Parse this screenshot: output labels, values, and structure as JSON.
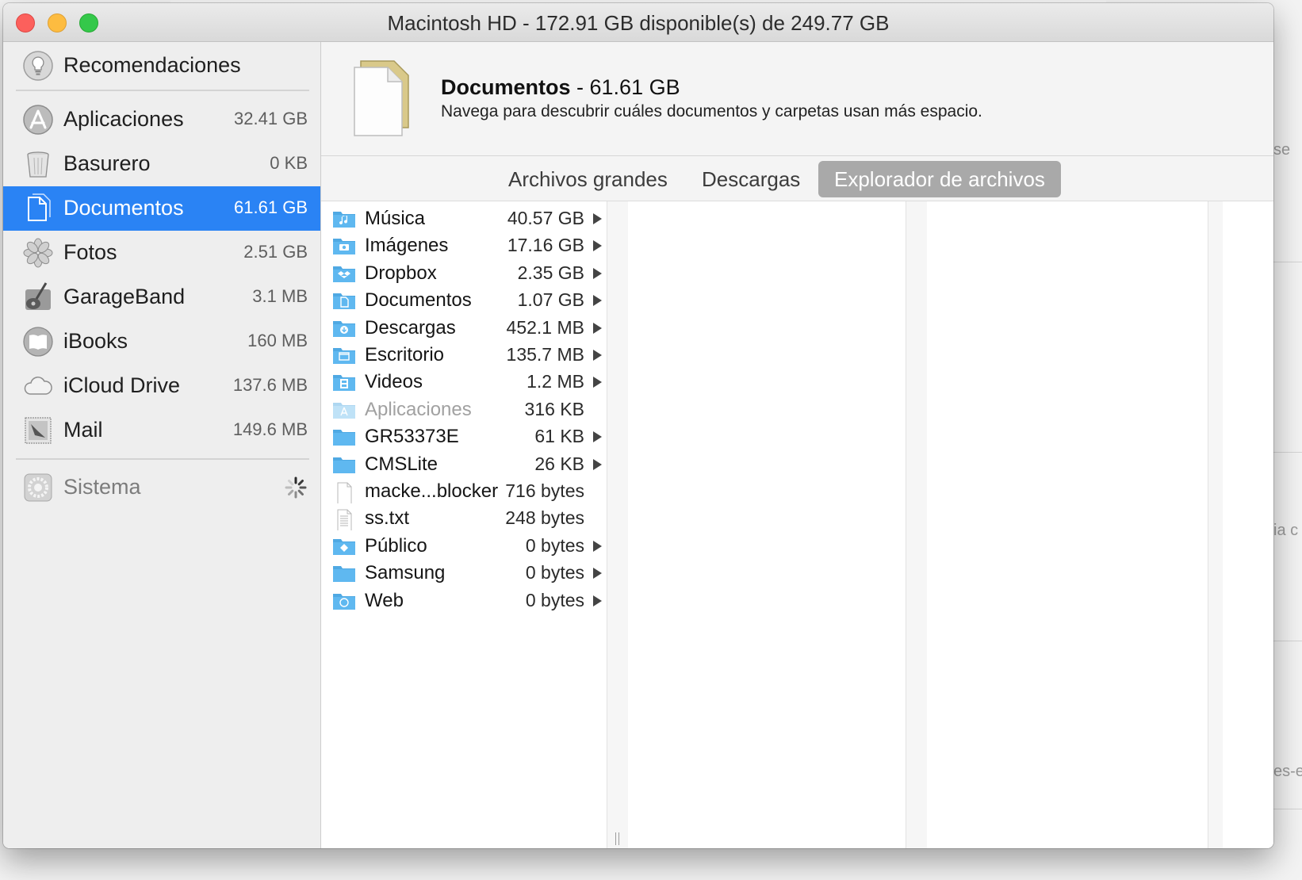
{
  "window": {
    "title": "Macintosh HD - 172.91 GB disponible(s) de 249.77 GB"
  },
  "sidebar": {
    "recommendations": {
      "label": "Recomendaciones",
      "icon": "lightbulb-icon"
    },
    "items": [
      {
        "label": "Aplicaciones",
        "size": "32.41 GB",
        "icon": "applications-icon",
        "selected": false
      },
      {
        "label": "Basurero",
        "size": "0 KB",
        "icon": "trash-icon",
        "selected": false
      },
      {
        "label": "Documentos",
        "size": "61.61 GB",
        "icon": "documents-icon",
        "selected": true
      },
      {
        "label": "Fotos",
        "size": "2.51 GB",
        "icon": "photos-icon",
        "selected": false
      },
      {
        "label": "GarageBand",
        "size": "3.1 MB",
        "icon": "garageband-icon",
        "selected": false
      },
      {
        "label": "iBooks",
        "size": "160 MB",
        "icon": "ibooks-icon",
        "selected": false
      },
      {
        "label": "iCloud Drive",
        "size": "137.6 MB",
        "icon": "icloud-icon",
        "selected": false
      },
      {
        "label": "Mail",
        "size": "149.6 MB",
        "icon": "mail-icon",
        "selected": false
      }
    ],
    "system": {
      "label": "Sistema",
      "icon": "system-gear-icon",
      "status_icon": "spinner-icon"
    }
  },
  "header": {
    "title": "Documentos",
    "size": " - 61.61 GB",
    "subtitle": "Navega para descubrir cuáles documentos y carpetas usan más espacio.",
    "icon": "document-file-icon"
  },
  "tabs": [
    {
      "label": "Archivos grandes",
      "active": false
    },
    {
      "label": "Descargas",
      "active": false
    },
    {
      "label": "Explorador de archivos",
      "active": true
    }
  ],
  "files": [
    {
      "name": "Música",
      "size": "40.57 GB",
      "kind": "folder",
      "badge": "music-note-icon",
      "expandable": true
    },
    {
      "name": "Imágenes",
      "size": "17.16 GB",
      "kind": "folder",
      "badge": "camera-icon",
      "expandable": true
    },
    {
      "name": "Dropbox",
      "size": "2.35 GB",
      "kind": "folder",
      "badge": "dropbox-icon",
      "expandable": true
    },
    {
      "name": "Documentos",
      "size": "1.07 GB",
      "kind": "folder",
      "badge": "document-icon",
      "expandable": true
    },
    {
      "name": "Descargas",
      "size": "452.1 MB",
      "kind": "folder",
      "badge": "download-icon",
      "expandable": true
    },
    {
      "name": "Escritorio",
      "size": "135.7 MB",
      "kind": "folder",
      "badge": "desktop-icon",
      "expandable": true
    },
    {
      "name": "Videos",
      "size": "1.2 MB",
      "kind": "folder",
      "badge": "film-icon",
      "expandable": true
    },
    {
      "name": "Aplicaciones",
      "size": "316 KB",
      "kind": "folder-dim",
      "badge": "apps-icon",
      "expandable": false
    },
    {
      "name": "GR53373E",
      "size": "61 KB",
      "kind": "folder",
      "badge": "",
      "expandable": true
    },
    {
      "name": "CMSLite",
      "size": "26 KB",
      "kind": "folder",
      "badge": "",
      "expandable": true
    },
    {
      "name": "macke...blocker",
      "size": "716 bytes",
      "kind": "file",
      "badge": "",
      "expandable": false
    },
    {
      "name": "ss.txt",
      "size": "248 bytes",
      "kind": "text-file",
      "badge": "",
      "expandable": false
    },
    {
      "name": "Público",
      "size": "0 bytes",
      "kind": "folder",
      "badge": "public-icon",
      "expandable": true
    },
    {
      "name": "Samsung",
      "size": "0 bytes",
      "kind": "folder",
      "badge": "",
      "expandable": true
    },
    {
      "name": "Web",
      "size": "0 bytes",
      "kind": "folder",
      "badge": "compass-icon",
      "expandable": true
    }
  ],
  "background": {
    "edge_texts": [
      "se",
      "ia c",
      "es-e"
    ]
  },
  "colors": {
    "accent": "#2a83f4",
    "folder": "#5fb8f0",
    "tab_active": "#a9a9a9"
  }
}
